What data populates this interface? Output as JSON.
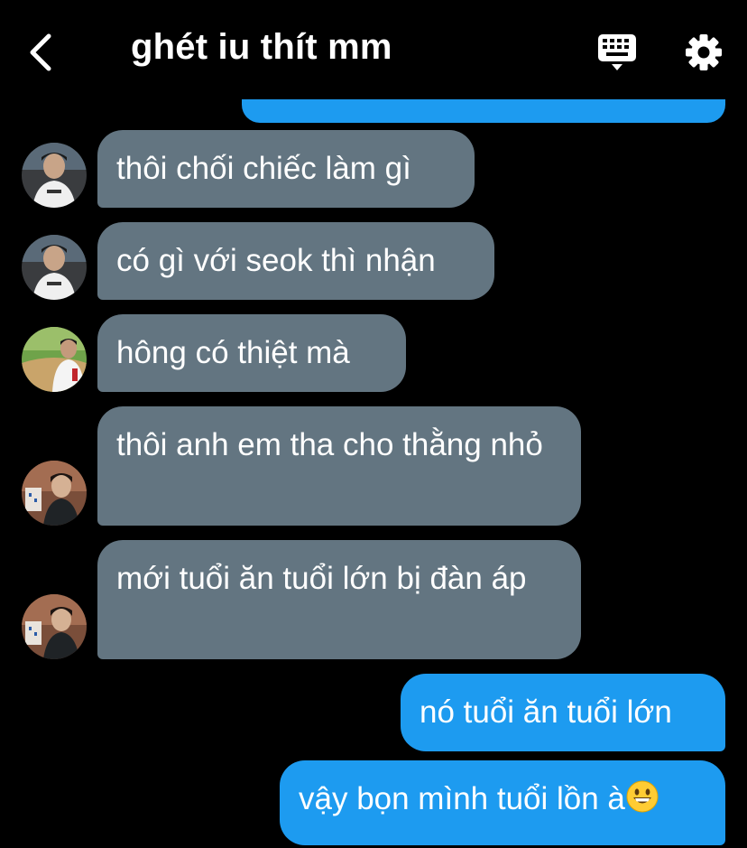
{
  "header": {
    "title": "ghét iu thít mm",
    "back_icon": "chevron-left-icon",
    "keyboard_icon": "keyboard-icon",
    "settings_icon": "gear-icon"
  },
  "colors": {
    "incoming_bubble": "#637581",
    "outgoing_bubble": "#1d9bf0",
    "background": "#000000"
  },
  "messages": [
    {
      "direction": "incoming",
      "text": "thôi chối chiếc làm gì"
    },
    {
      "direction": "incoming",
      "text": "có gì với seok thì nhận"
    },
    {
      "direction": "incoming",
      "text": "hông có thiệt mà"
    },
    {
      "direction": "incoming",
      "text": "thôi anh em tha cho thằng nhỏ"
    },
    {
      "direction": "incoming",
      "text": "mới tuổi ăn tuổi lớn bị đàn áp"
    },
    {
      "direction": "outgoing",
      "text": "nó tuổi ăn tuổi lớn"
    },
    {
      "direction": "outgoing",
      "text": "vậy bọn mình tuổi lồn à",
      "emoji": "grinning-face-emoji"
    }
  ]
}
